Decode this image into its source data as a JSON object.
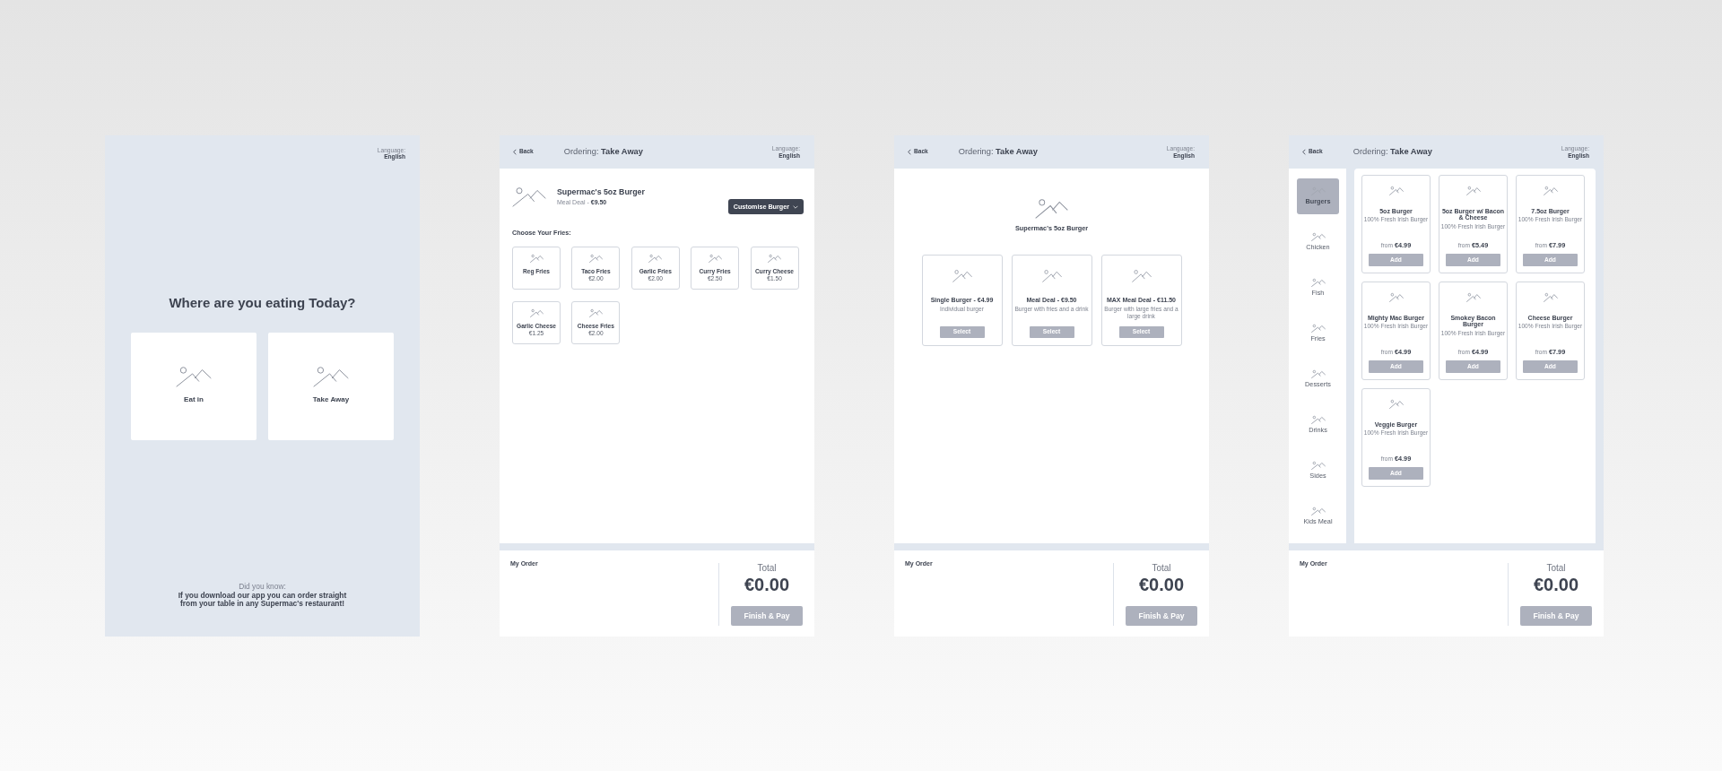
{
  "screens": [
    {
      "kind": "welcome",
      "language": {
        "label": "Language:",
        "value": "English"
      },
      "heading": "Where are you eating Today?",
      "options": [
        {
          "label": "Eat in"
        },
        {
          "label": "Take Away"
        }
      ],
      "tip": {
        "title": "Did you know:",
        "text": "If you download our app you can order straight from your table in any Supermac's restaurant!"
      }
    },
    {
      "kind": "fries",
      "header": {
        "back": "Back",
        "title": "Ordering: **Take Away**",
        "language": {
          "label": "Language:",
          "value": "English"
        }
      },
      "product": {
        "name": "Supermac's 5oz Burger",
        "detail": "Meal Deal - **€9.50**"
      },
      "customise_button": "Customise Burger",
      "section_title": "Choose Your Fries:",
      "fries": [
        {
          "name": "Reg Fries"
        },
        {
          "name": "Taco Fries",
          "price": "€2.00"
        },
        {
          "name": "Garlic Fries",
          "price": "€2.00"
        },
        {
          "name": "Curry Fries",
          "price": "€2.50"
        },
        {
          "name": "Curry Cheese",
          "price": "€1.50"
        },
        {
          "name": "Garlic Cheese",
          "price": "€1.25"
        },
        {
          "name": "Cheese Fries",
          "price": "€2.00"
        }
      ],
      "order": {
        "title": "My Order",
        "total_label": "Total",
        "total": "€0.00",
        "pay_button": "Finish & Pay"
      }
    },
    {
      "kind": "deal",
      "header": {
        "back": "Back",
        "title": "Ordering: **Take Away**",
        "language": {
          "label": "Language:",
          "value": "English"
        }
      },
      "product": {
        "name": "Supermac's 5oz Burger"
      },
      "deals": [
        {
          "title": "Single Burger - €4.99",
          "description": "Individual burger",
          "button": "Select"
        },
        {
          "title": "Meal Deal - €9.50",
          "description": "Burger with fries and a drink",
          "button": "Select"
        },
        {
          "title": "MAX Meal Deal - €11.50",
          "description": "Burger with large fries and a large drink",
          "button": "Select"
        }
      ],
      "order": {
        "title": "My Order",
        "total_label": "Total",
        "total": "€0.00",
        "pay_button": "Finish & Pay"
      }
    },
    {
      "kind": "menu",
      "header": {
        "back": "Back",
        "title": "Ordering: **Take Away**",
        "language": {
          "label": "Language:",
          "value": "English"
        }
      },
      "categories": [
        {
          "label": "Burgers",
          "selected": true
        },
        {
          "label": "Chicken",
          "selected": false
        },
        {
          "label": "Fish",
          "selected": false
        },
        {
          "label": "Fries",
          "selected": false
        },
        {
          "label": "Desserts",
          "selected": false
        },
        {
          "label": "Drinks",
          "selected": false
        },
        {
          "label": "Sides",
          "selected": false
        },
        {
          "label": "Kids Meal",
          "selected": false
        }
      ],
      "products": [
        {
          "name": "5oz Burger",
          "description": "100% Fresh Irish Burger",
          "price_prefix": "from",
          "price": "€4.99",
          "button": "Add"
        },
        {
          "name": "5oz Burger w/ Bacon & Cheese",
          "description": "100% Fresh Irish Burger",
          "price_prefix": "from",
          "price": "€5.49",
          "button": "Add"
        },
        {
          "name": "7.5oz Burger",
          "description": "100% Fresh Irish Burger",
          "price_prefix": "from",
          "price": "€7.99",
          "button": "Add"
        },
        {
          "name": "Mighty Mac Burger",
          "description": "100% Fresh Irish Burger",
          "price_prefix": "from",
          "price": "€4.99",
          "button": "Add"
        },
        {
          "name": "Smokey Bacon Burger",
          "description": "100% Fresh Irish Burger",
          "price_prefix": "from",
          "price": "€4.99",
          "button": "Add"
        },
        {
          "name": "Cheese Burger",
          "description": "100% Fresh Irish Burger",
          "price_prefix": "from",
          "price": "€7.99",
          "button": "Add"
        },
        {
          "name": "Veggie Burger",
          "description": "100% Fresh Irish Burger",
          "price_prefix": "from",
          "price": "€4.99",
          "button": "Add"
        }
      ],
      "order": {
        "title": "My Order",
        "total_label": "Total",
        "total": "€0.00",
        "pay_button": "Finish & Pay"
      }
    }
  ]
}
